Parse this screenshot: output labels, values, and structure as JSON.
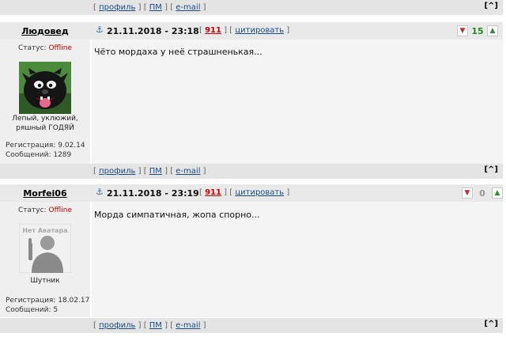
{
  "actions": {
    "profile": "профиль",
    "pm": "ПМ",
    "email": "e-mail",
    "top": "[^]"
  },
  "posts": [
    {
      "nick": "Людовед",
      "date": "21.11.2018 - 23:18",
      "post_num": "911",
      "cite": "цитировать",
      "rating": "15",
      "status_label": "Статус:",
      "status": "Offline",
      "title_line1": "Лепый, уклюжий,",
      "title_line2": "ряшный ГОДЯЙ",
      "registration": "Регистрация: 9.02.14",
      "messages": "Сообщений: 1289",
      "text": "Чёто мордаха у неё страшненькая..."
    },
    {
      "nick": "Morfei06",
      "date": "21.11.2018 - 23:19",
      "post_num": "911",
      "cite": "цитировать",
      "rating": "0",
      "status_label": "Статус:",
      "status": "Offline",
      "avatar_text": "Нет Аватара",
      "title_line1": "Шутник",
      "registration": "Регистрация: 18.02.17",
      "messages": "Сообщений: 5",
      "text": "Морда симпатичная, жопа спорно..."
    }
  ],
  "colors": {
    "link": "#1a4c8a",
    "offline": "#cc0000",
    "post_num": "#cc0000",
    "rating_positive": "#238a23",
    "rating_zero": "#999999"
  }
}
